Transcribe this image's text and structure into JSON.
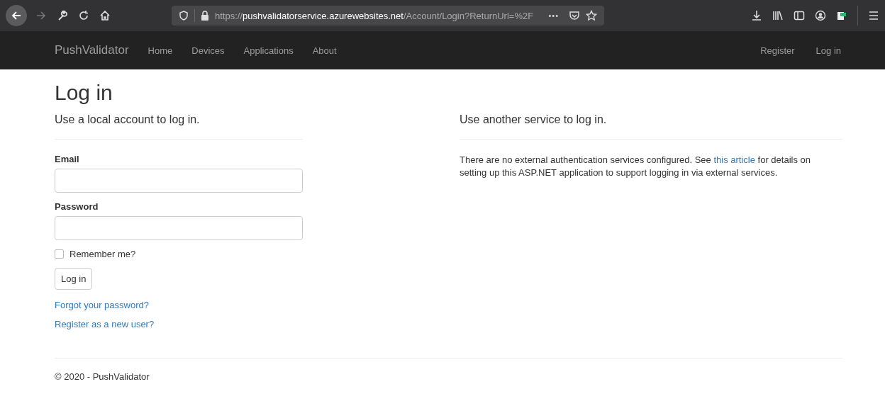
{
  "browser": {
    "url_scheme": "https://",
    "url_host": "pushvalidatorservice.azurewebsites.net",
    "url_path": "/Account/Login?ReturnUrl=%2F",
    "more": "•••"
  },
  "navbar": {
    "brand": "PushValidator",
    "items": [
      "Home",
      "Devices",
      "Applications",
      "About"
    ],
    "right_items": [
      "Register",
      "Log in"
    ]
  },
  "title": "Log in",
  "local": {
    "heading": "Use a local account to log in.",
    "fields": [
      {
        "label": "Email"
      },
      {
        "label": "Password"
      }
    ],
    "remember": {
      "label": "Remember me?",
      "checked": false
    },
    "submit": "Log in",
    "links": [
      "Forgot your password?",
      "Register as a new user?"
    ]
  },
  "external": {
    "heading": "Use another service to log in.",
    "text_before": "There are no external authentication services configured. See ",
    "link": "this article",
    "text_after": " for details on setting up this ASP.NET application to support logging in via external services."
  },
  "footer": "© 2020 - PushValidator"
}
